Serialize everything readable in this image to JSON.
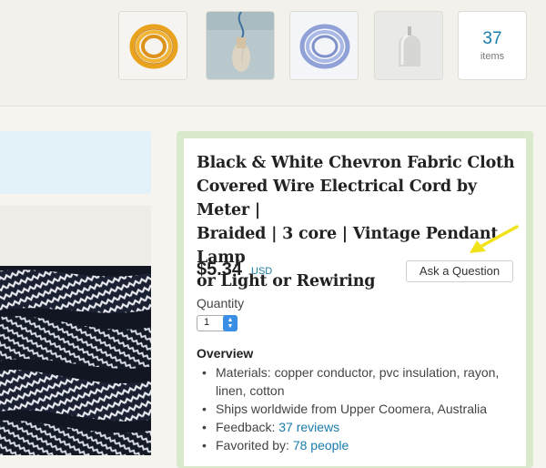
{
  "header": {
    "thumbnails": [
      {
        "name": "orange-fabric-cord-thumbnail"
      },
      {
        "name": "pendant-lamp-thumbnail"
      },
      {
        "name": "blue-fabric-cord-thumbnail"
      },
      {
        "name": "white-lamp-socket-thumbnail"
      }
    ],
    "items_count": "37",
    "items_label": "items"
  },
  "listing": {
    "title_lines": [
      "Black & White Chevron Fabric Cloth",
      "Covered Wire Electrical Cord by Meter |",
      "Braided | 3 core | Vintage Pendant Lamp",
      "or Light or Rewiring"
    ],
    "price": "$5.34",
    "currency": "USD",
    "ask_button": "Ask a Question",
    "quantity_label": "Quantity",
    "quantity_value": "1",
    "overview_heading": "Overview",
    "overview": [
      {
        "text": "Materials: copper conductor, pvc insulation, rayon, linen, cotton"
      },
      {
        "text": "Ships worldwide from Upper Coomera, Australia"
      },
      {
        "text": "Feedback: ",
        "link": "37 reviews"
      },
      {
        "text": "Favorited by: ",
        "link": "78 people"
      }
    ]
  },
  "colors": {
    "link": "#1a7bab",
    "panel_border": "#d9e9cc",
    "banner": "#e3f2f8",
    "annotation_arrow": "#f2e21a",
    "stepper": "#3a8ee6"
  }
}
